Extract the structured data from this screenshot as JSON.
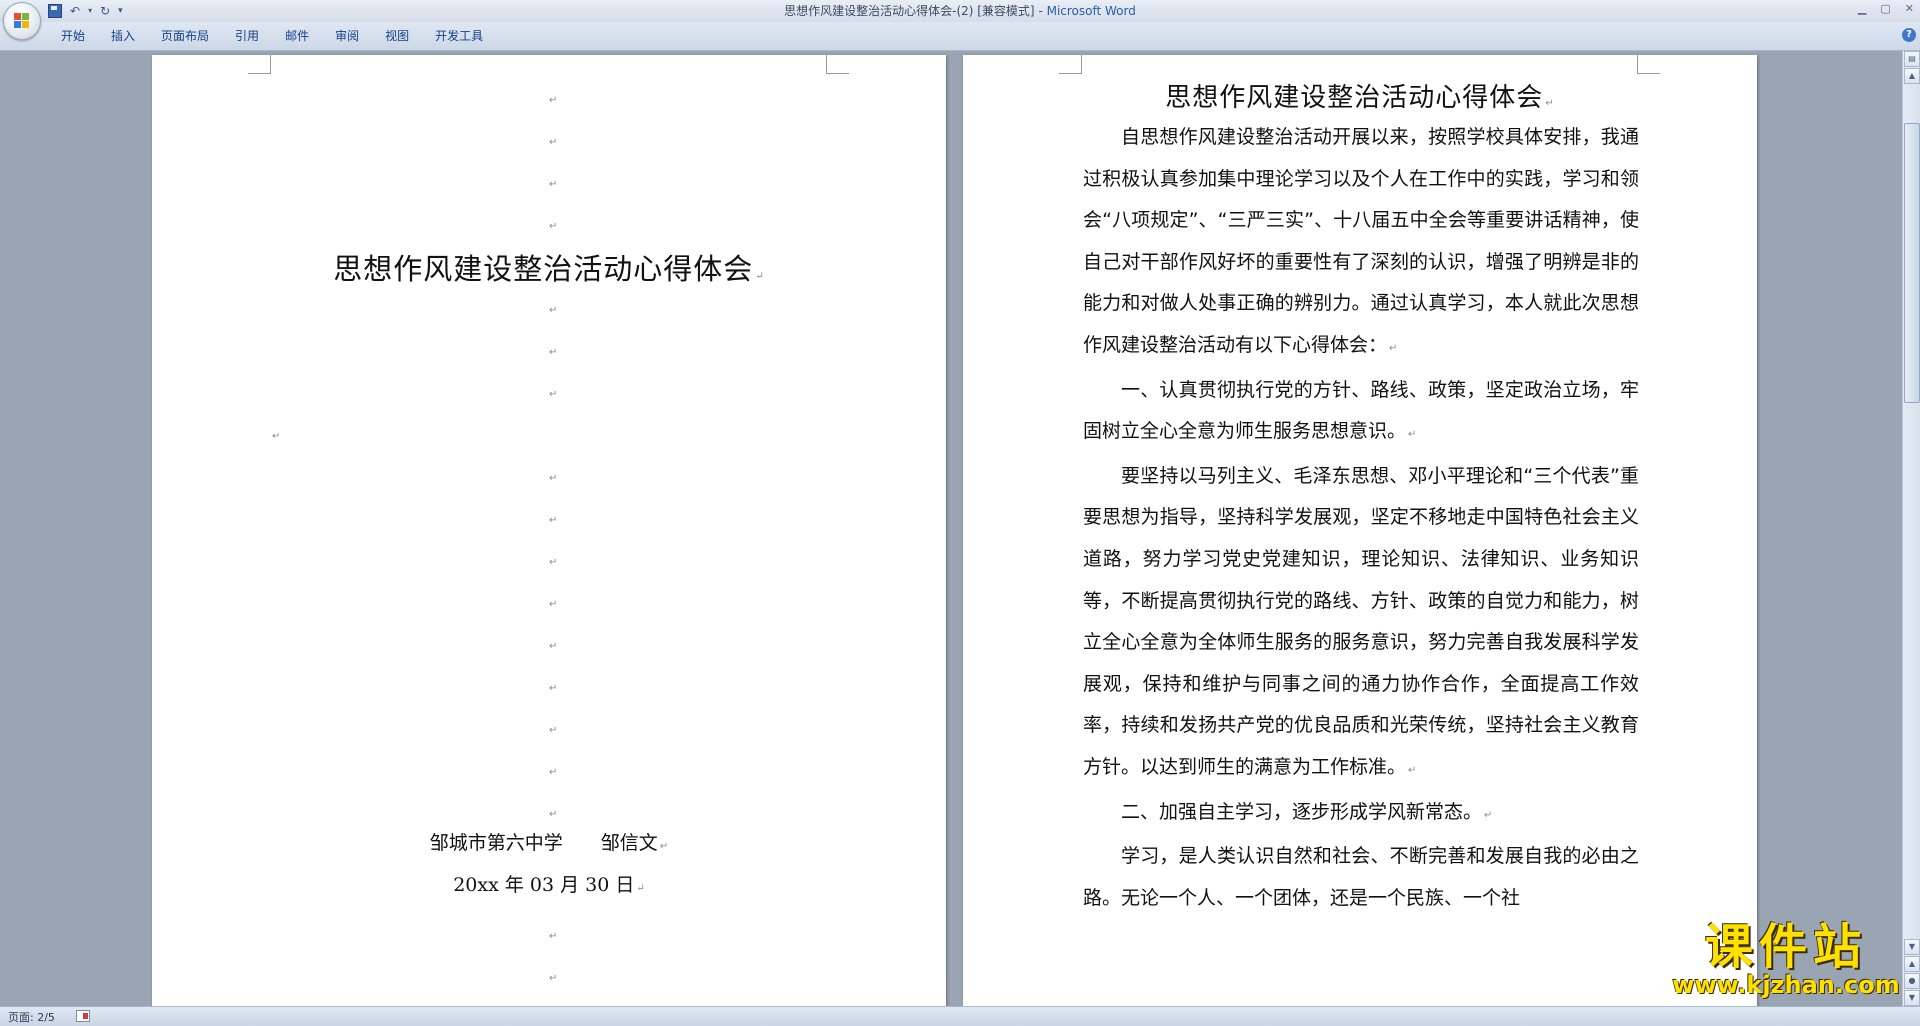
{
  "window": {
    "title_doc": "思想作风建设整治活动心得体会-(2) [兼容模式]",
    "title_sep": " - ",
    "title_app": "Microsoft Word"
  },
  "ribbon": {
    "tabs": [
      "开始",
      "插入",
      "页面布局",
      "引用",
      "邮件",
      "审阅",
      "视图",
      "开发工具"
    ]
  },
  "page1": {
    "title": "思想作风建设整治活动心得体会",
    "author_line": "邹城市第六中学　　邹信文",
    "date": "20xx 年 03 月 30 日"
  },
  "page2": {
    "title": "思想作风建设整治活动心得体会",
    "paragraphs": [
      "自思想作风建设整治活动开展以来，按照学校具体安排，我通过积极认真参加集中理论学习以及个人在工作中的实践，学习和领会“八项规定”、“三严三实”、十八届五中全会等重要讲话精神，使自己对干部作风好坏的重要性有了深刻的认识，增强了明辨是非的能力和对做人处事正确的辨别力。通过认真学习，本人就此次思想作风建设整治活动有以下心得体会：",
      "一、认真贯彻执行党的方针、路线、政策，坚定政治立场，牢固树立全心全意为师生服务思想意识。",
      "要坚持以马列主义、毛泽东思想、邓小平理论和“三个代表”重要思想为指导，坚持科学发展观，坚定不移地走中国特色社会主义道路，努力学习党史党建知识，理论知识、法律知识、业务知识等，不断提高贯彻执行党的路线、方针、政策的自觉力和能力，树立全心全意为全体师生服务的服务意识，努力完善自我发展科学发展观，保持和维护与同事之间的通力协作合作，全面提高工作效率，持续和发扬共产党的优良品质和光荣传统，坚持社会主义教育方针。以达到师生的满意为工作标准。",
      "二、加强自主学习，逐步形成学风新常态。",
      "学习，是人类认识自然和社会、不断完善和发展自我的必由之路。无论一个人、一个团体，还是一个民族、一个社"
    ]
  },
  "status": {
    "page_indicator": "页面: 2/5"
  },
  "watermark": {
    "cn": "课件站",
    "url": "www.kjzhan.com"
  },
  "colors": {
    "ribbon_text": "#15428b",
    "app_title": "#2a5ca8",
    "watermark": "#ffe100",
    "workspace": "#9aa5b3"
  }
}
